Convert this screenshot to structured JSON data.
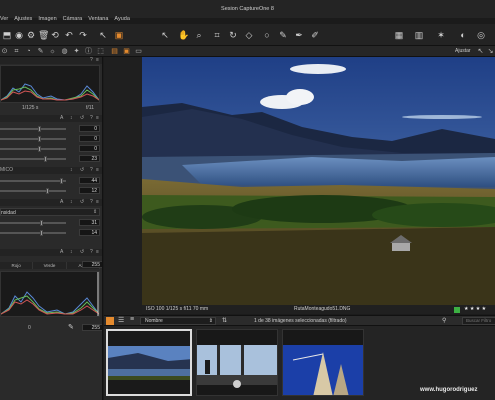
{
  "window": {
    "title": "Sesion CaptureOne 8"
  },
  "menu": [
    "Ver",
    "Ajustes",
    "Imagen",
    "Cámara",
    "Ventana",
    "Ayuda"
  ],
  "toolstrip": {
    "adjust_label": "Ajustar"
  },
  "left_panel": {
    "histogram_labels": {
      "shutter": "1/125 s",
      "aperture": "f/11"
    },
    "exposure_values": [
      "0",
      "0",
      "0",
      "23"
    ],
    "hdr_label": "MICO",
    "hdr_values": [
      "44",
      "12"
    ],
    "clarity_label": "nsidad",
    "clarity_values": [
      "31",
      "14"
    ],
    "levels_tabs": [
      "Rojo",
      "Verde",
      "Azul"
    ],
    "levels_top_value": "255",
    "levels_input_low": "0",
    "levels_input_high": "255"
  },
  "viewer": {
    "exif": "ISO 100  1/125 s  f/11  70 mm",
    "filename": "RutaMonteagudo51.DNG",
    "rating": "★ ★ ★ ★"
  },
  "browser": {
    "sort_label": "Nombre",
    "selection_count": "1 de 38 imágenes seleccionadas (filtrado)",
    "search_placeholder": "Buscar Filtro"
  },
  "watermark": "www.hugorodriguez"
}
